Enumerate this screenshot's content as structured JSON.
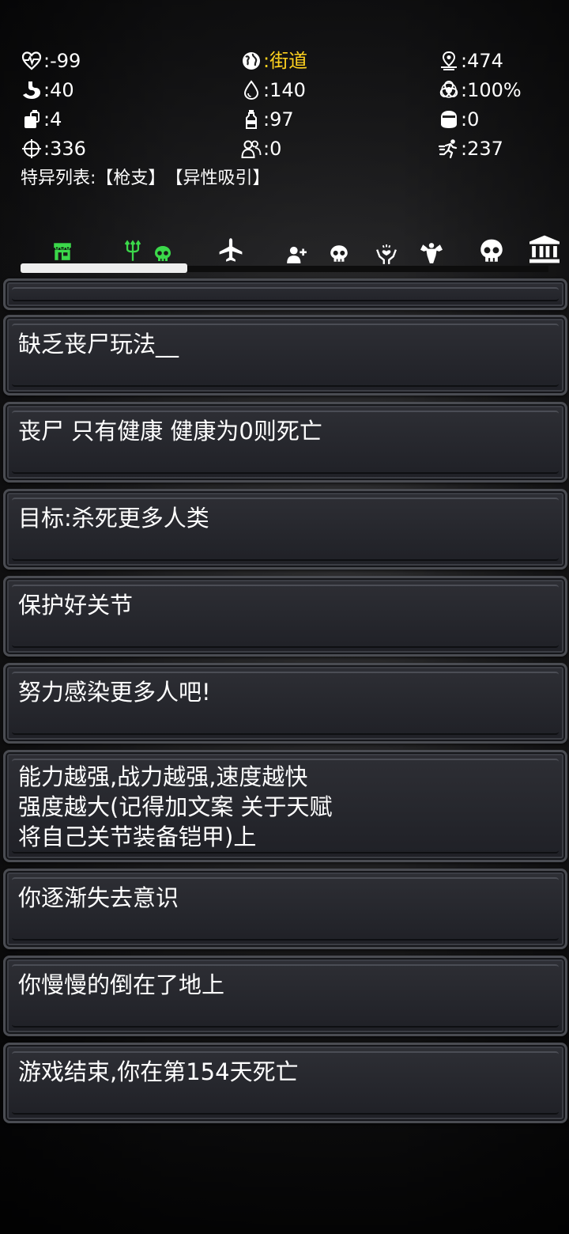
{
  "stats": [
    [
      {
        "icon": "heart-pulse-icon",
        "value": ":-99"
      },
      {
        "icon": "globe-icon",
        "value": ":街道",
        "highlight": "#ffd21f"
      },
      {
        "icon": "location-pin-icon",
        "value": ":474"
      }
    ],
    [
      {
        "icon": "stomach-icon",
        "value": ":40"
      },
      {
        "icon": "water-drop-icon",
        "value": ":140"
      },
      {
        "icon": "biohazard-icon",
        "value": ":100%"
      }
    ],
    [
      {
        "icon": "food-can-icon",
        "value": ":4"
      },
      {
        "icon": "bottle-icon",
        "value": ":97"
      },
      {
        "icon": "helmet-icon",
        "value": ":0"
      }
    ],
    [
      {
        "icon": "crosshair-icon",
        "value": ":336"
      },
      {
        "icon": "people-icon",
        "value": ":0"
      },
      {
        "icon": "running-icon",
        "value": ":237"
      }
    ]
  ],
  "traits": {
    "label": "特异列表:",
    "items": [
      "【枪支】",
      "【异性吸引】"
    ]
  },
  "tabs": [
    {
      "icon": "shop-icon",
      "color": "#3bd84a",
      "active": true
    },
    {
      "icon": "trident-skull-icon",
      "color": "#3bd84a"
    },
    {
      "icon": "airplane-icon",
      "color": "#ffffff"
    },
    {
      "icon": "add-user-icon",
      "color": "#ffffff"
    },
    {
      "icon": "skull-icon",
      "color": "#ffffff"
    },
    {
      "icon": "hands-heart-icon",
      "color": "#ffffff"
    },
    {
      "icon": "muscle-icon",
      "color": "#ffffff"
    },
    {
      "icon": "skull-large-icon",
      "color": "#ffffff"
    },
    {
      "icon": "bank-icon",
      "color": "#ffffff"
    }
  ],
  "log": [
    "缺乏丧尸玩法__",
    "丧尸 只有健康 健康为0则死亡",
    "目标:杀死更多人类",
    "保护好关节",
    "努力感染更多人吧!",
    "能力越强,战力越强,速度越快\n强度越大(记得加文案 关于天赋\n将自己关节装备铠甲)上",
    "你逐渐失去意识",
    "你慢慢的倒在了地上",
    "游戏结束,你在第154天死亡"
  ]
}
